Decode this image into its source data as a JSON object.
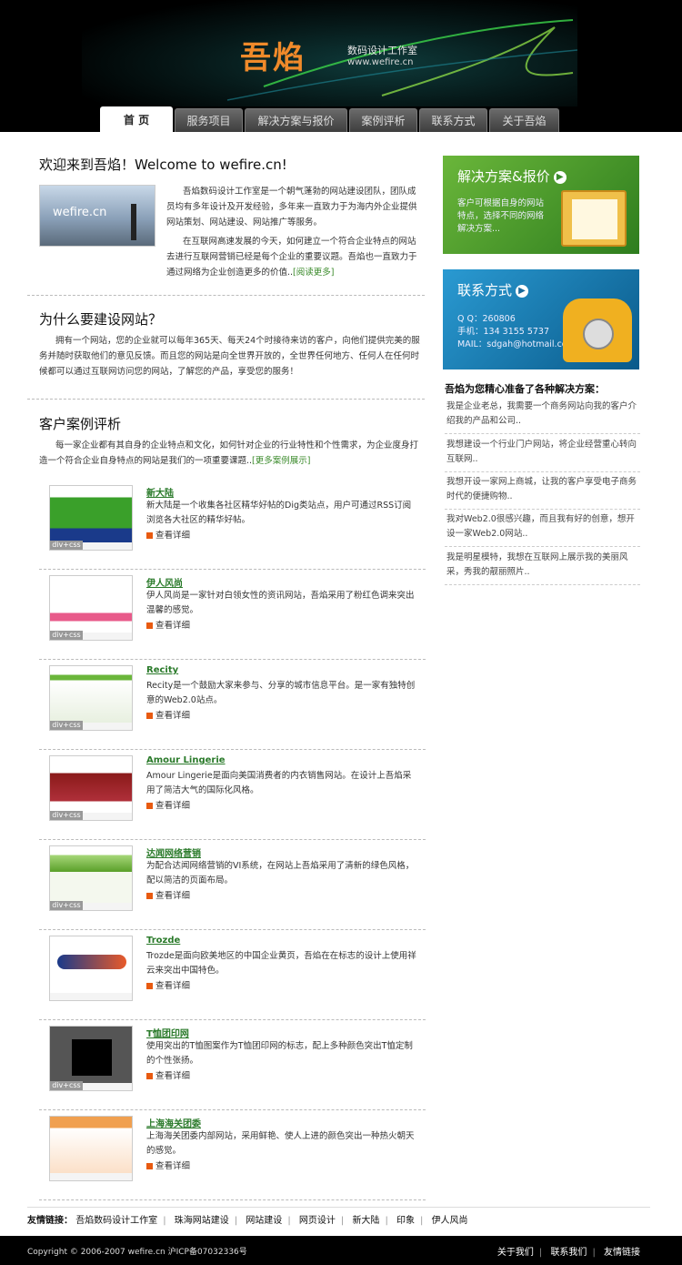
{
  "header": {
    "logo": "吾焰",
    "subtitle": "数码设计工作室",
    "url": "www.wefire.cn"
  },
  "nav": [
    "首 页",
    "服务项目",
    "解决方案与报价",
    "案例评析",
    "联系方式",
    "关于吾焰"
  ],
  "welcome": {
    "title": "欢迎来到吾焰！Welcome to wefire.cn!",
    "img_text": "wefire.cn",
    "p1": "吾焰数码设计工作室是一个朝气蓬勃的网站建设团队，团队成员均有多年设计及开发经验，多年来一直致力于为海内外企业提供网站策划、网站建设、网站推广等服务。",
    "p2": "在互联网高速发展的今天，如何建立一个符合企业特点的网站去进行互联网营销已经是每个企业的重要议题。吾焰也一直致力于通过网络为企业创造更多的价值..",
    "more": "[阅读更多]"
  },
  "why": {
    "title": "为什么要建设网站？",
    "text": "拥有一个网站，您的企业就可以每年365天、每天24个时接待来访的客户，向他们提供完美的服务并随时获取他们的意见反馈。而且您的网站是向全世界开放的，全世界任何地方、任何人在任何时候都可以通过互联网访问您的网站，了解您的产品，享受您的服务！"
  },
  "cases": {
    "title": "客户案例评析",
    "intro": "每一家企业都有其自身的企业特点和文化，如何针对企业的行业特性和个性需求，为企业度身打造一个符合企业自身特点的网站是我们的一项重要课题..",
    "more": "[更多案例展示]",
    "detail_label": "查看详细",
    "tag": "div+css",
    "items": [
      {
        "title": "新大陆",
        "desc": "新大陆是一个收集各社区精华好帖的Dig类站点，用户可通过RSS订阅浏览各大社区的精华好帖。"
      },
      {
        "title": "伊人风尚",
        "desc": "伊人风尚是一家针对白领女性的资讯网站，吾焰采用了粉红色调来突出温馨的感觉。"
      },
      {
        "title": "Recity",
        "desc": "Recity是一个鼓励大家来参与、分享的城市信息平台。是一家有独特创意的Web2.0站点。"
      },
      {
        "title": "Amour Lingerie",
        "desc": "Amour Lingerie是面向美国消费者的内衣销售网站。在设计上吾焰采用了简洁大气的国际化风格。"
      },
      {
        "title": "达闻网络营销",
        "desc": "为配合达闻网络营销的VI系统，在网站上吾焰采用了清新的绿色风格，配以简洁的页面布局。"
      },
      {
        "title": "Trozde",
        "desc": "Trozde是面向欧美地区的中国企业黄页，吾焰在在标志的设计上使用祥云来突出中国特色。"
      },
      {
        "title": "T恤团印网",
        "desc": "使用突出的T恤图案作为T恤团印网的标志，配上多种颜色突出T恤定制的个性张扬。"
      },
      {
        "title": "上海海关团委",
        "desc": "上海海关团委内部网站，采用鲜艳、使人上进的颜色突出一种热火朝天的感觉。"
      }
    ]
  },
  "sidebar": {
    "box1": {
      "title": "解决方案&报价",
      "text": "客户可根据自身的网站特点，选择不同的网络解决方案..."
    },
    "box2": {
      "title": "联系方式",
      "qq": "Q Q：260806",
      "phone": "手机：134 3155 5737",
      "mail": "MAIL：sdgah@hotmail.com"
    },
    "solutions_title": "吾焰为您精心准备了各种解决方案：",
    "solutions": [
      "我是企业老总，我需要一个商务网站向我的客户介绍我的产品和公司..",
      "我想建设一个行业门户网站，将企业经营重心转向互联网..",
      "我想开设一家网上商城，让我的客户享受电子商务时代的便捷购物..",
      "我对Web2.0很感兴趣，而且我有好的创意，想开设一家Web2.0网站..",
      "我是明星模特，我想在互联网上展示我的美丽风采，秀我的靓丽照片.."
    ]
  },
  "friends": {
    "label": "友情链接：",
    "links": [
      "吾焰数码设计工作室",
      "珠海网站建设",
      "网站建设",
      "网页设计",
      "新大陆",
      "印象",
      "伊人风尚"
    ]
  },
  "footer": {
    "copyright": "Copyright © 2006-2007 wefire.cn 沪ICP备07032336号",
    "links": [
      "关于我们",
      "联系我们",
      "友情链接"
    ]
  }
}
